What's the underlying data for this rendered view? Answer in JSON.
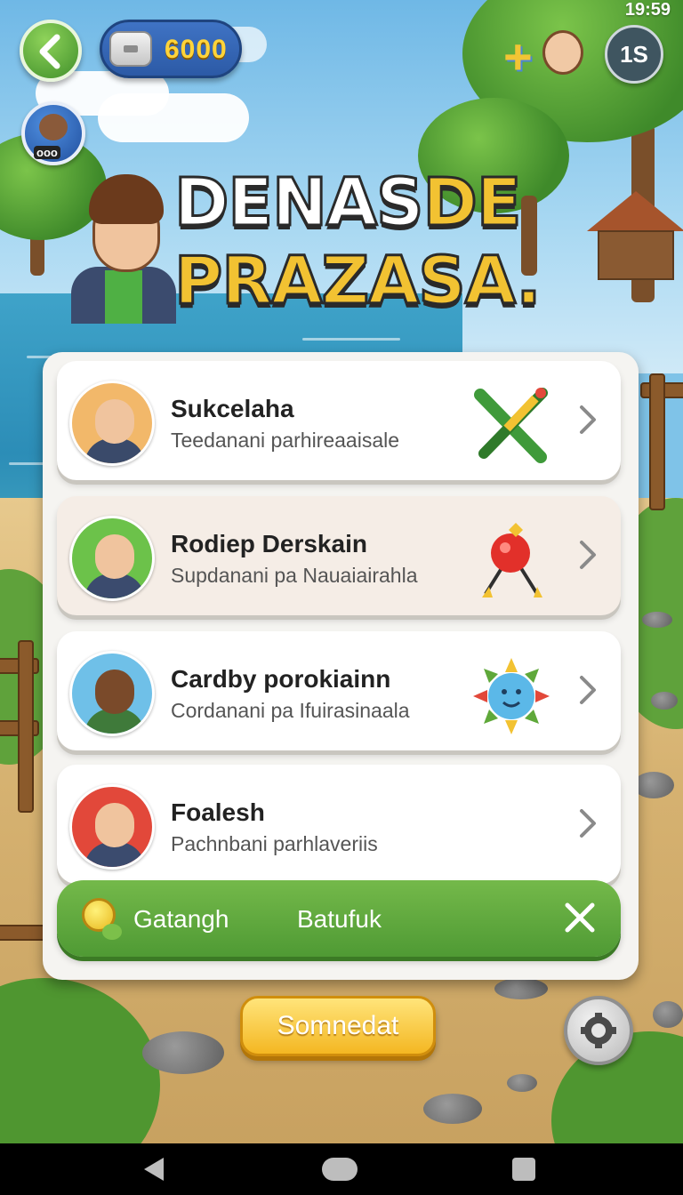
{
  "status_bar": {
    "time": "19:59"
  },
  "hud": {
    "coins": "6000",
    "avatar_stats": "ooo",
    "level": "1S"
  },
  "title": {
    "line1_white": "DENAS",
    "line1_gold": "DE",
    "line2": "PRAZASA."
  },
  "list": [
    {
      "name": "Sukcelaha",
      "desc": "Teedanani parhireaaisale",
      "icon": "brush-pencil-icon",
      "bg": "white",
      "avatar_color": "#f2b86a",
      "torso_color": "#3a4a6a"
    },
    {
      "name": "Rodiep Derskain",
      "desc": "Supdanani pa Nauaiairahla",
      "icon": "red-bomb-icon",
      "bg": "beige",
      "avatar_color": "#6cc24a",
      "torso_color": "#3b4b6e"
    },
    {
      "name": "Cardby porokiainn",
      "desc": "Cordanani pa Ifuirasinaala",
      "icon": "blue-sun-icon",
      "bg": "white",
      "avatar_color": "#6fc0e8",
      "torso_color": "#3f7a3a"
    },
    {
      "name": "Foalesh",
      "desc": "Pachnbani parhlaveriis",
      "icon": "",
      "bg": "white",
      "avatar_color": "#e2483a",
      "torso_color": "#3b4b6e"
    }
  ],
  "green_bar": {
    "label1": "Gatangh",
    "label2": "Batufuk"
  },
  "confirm_button": "Somnedat",
  "colors": {
    "accent_green": "#5fa83a",
    "gold": "#f2c232",
    "coin_blue": "#3f73c4"
  }
}
